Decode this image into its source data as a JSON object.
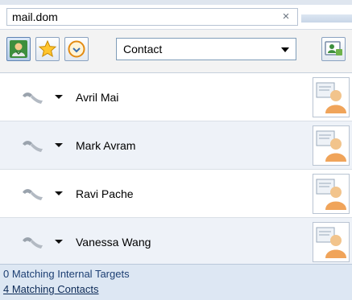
{
  "search": {
    "value": "mail.dom",
    "clear_label": "×"
  },
  "toolbar": {
    "buttons": [
      {
        "name": "contacts-person-icon",
        "selected": true
      },
      {
        "name": "favorites-star-icon",
        "selected": false
      },
      {
        "name": "recent-clock-icon",
        "selected": false
      }
    ],
    "filter_selected": "Contact",
    "add_icon": "add-contact-card-icon"
  },
  "contacts": [
    {
      "name": "Avril Mai",
      "icon": "phone-handset-icon",
      "card_icon": "contact-card-icon"
    },
    {
      "name": "Mark Avram",
      "icon": "phone-handset-icon",
      "card_icon": "contact-card-icon"
    },
    {
      "name": "Ravi Pache",
      "icon": "phone-handset-icon",
      "card_icon": "contact-card-icon"
    },
    {
      "name": "Vanessa Wang",
      "icon": "phone-handset-icon",
      "card_icon": "contact-card-icon"
    }
  ],
  "footer": {
    "internal_targets": "0 Matching Internal Targets",
    "contacts": "4 Matching Contacts"
  },
  "colors": {
    "footer_bg": "#dde7f3",
    "row_alt_bg": "#eef2f8",
    "accent_border": "#7f9db9"
  }
}
